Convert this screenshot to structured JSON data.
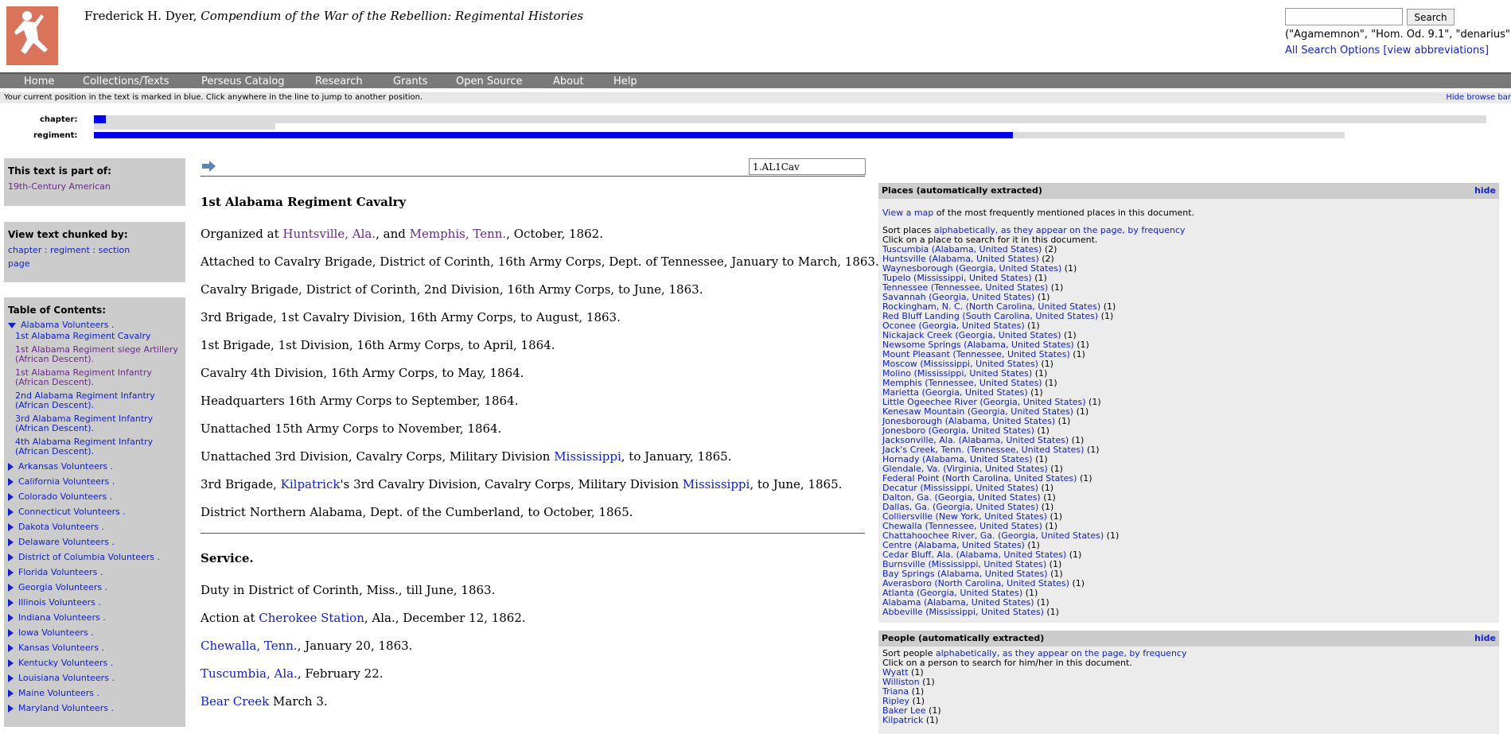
{
  "header": {
    "title_author": "Frederick H. Dyer, ",
    "title_work": "Compendium of the War of the Rebellion: Regimental Histories",
    "search_button": "Search",
    "search_examples": "(\"Agamemnon\", \"Hom. Od. 9.1\", \"denarius\")",
    "all_search_options": "All Search Options",
    "view_abbreviations": "[view abbreviations]"
  },
  "nav": [
    "Home",
    "Collections/Texts",
    "Perseus Catalog",
    "Research",
    "Grants",
    "Open Source",
    "About",
    "Help"
  ],
  "browse": {
    "note": "Your current position in the text is marked in blue. Click anywhere in the line to jump to another position.",
    "hide_label": "Hide browse bar",
    "chapter_label": "chapter:",
    "regiment_label": "regiment:"
  },
  "sidebar": {
    "part_of_title": "This text is part of:",
    "part_of_link": "19th-Century American",
    "chunked_title": "View text chunked by:",
    "chunk_options_line1": "chapter : regiment : section",
    "chunk_options_line2": "page",
    "toc_title": "Table of Contents:",
    "toc_expanded": "Alabama Volunteers .",
    "toc_sub": [
      "1st Alabama Regiment Cavalry",
      "1st Alabama Regiment siege Artillery (African Descent).",
      "1st Alabama Regiment Infantry (African Descent).",
      "2nd Alabama Regiment Infantry (African Descent).",
      "3rd Alabama Regiment Infantry (African Descent).",
      "4th Alabama Regiment Infantry (African Descent)."
    ],
    "toc_items": [
      "Arkansas Volunteers .",
      "California Volunteers .",
      "Colorado Volunteers .",
      "Connecticut Volunteers .",
      "Dakota Volunteers .",
      "Delaware Volunteers .",
      "District of Columbia Volunteers .",
      "Florida Volunteers .",
      "Georgia Volunteers .",
      "Illinois Volunteers .",
      "Indiana Volunteers .",
      "Iowa Volunteers .",
      "Kansas Volunteers .",
      "Kentucky Volunteers .",
      "Louisiana Volunteers .",
      "Maine Volunteers .",
      "Maryland Volunteers ."
    ]
  },
  "main": {
    "position_value": "1.AL1Cav",
    "heading": "1st Alabama Regiment Cavalry",
    "p1": {
      "a": "Organized at ",
      "b": "Huntsville, Ala.",
      "c": ", and ",
      "d": "Memphis, Tenn.",
      "e": ", October, 1862."
    },
    "lines": [
      "Attached to Cavalry Brigade, District of Corinth, 16th Army Corps, Dept. of Tennessee, January to March, 1863.",
      "Cavalry Brigade, District of Corinth, 2nd Division, 16th Army Corps, to June, 1863.",
      "3rd Brigade, 1st Cavalry Division, 16th Army Corps, to August, 1863.",
      "1st Brigade, 1st Division, 16th Army Corps, to April, 1864.",
      "Cavalry 4th Division, 16th Army Corps, to May, 1864.",
      "Headquarters 16th Army Corps to September, 1864.",
      "Unattached 15th Army Corps to November, 1864."
    ],
    "p9": {
      "a": "Unattached 3rd Division, Cavalry Corps, Military Division ",
      "b": "Mississippi",
      "c": ", to January, 1865."
    },
    "p10": {
      "a": "3rd Brigade, ",
      "b": "Kilpatrick",
      "c": "'s 3rd Cavalry Division, Cavalry Corps, Military Division ",
      "d": "Mississippi",
      "e": ", to June, 1865."
    },
    "p11": "District Northern Alabama, Dept. of the Cumberland, to October, 1865.",
    "service_heading": "Service.",
    "s1": "Duty in District of Corinth, Miss., till June, 1863.",
    "s2": {
      "a": "Action at ",
      "b": "Cherokee Station",
      "c": ", Ala., December 12, 1862."
    },
    "s3": {
      "a": "Chewalla, Tenn.",
      "b": ", January 20, 1863."
    },
    "s4": {
      "a": "Tuscumbia, Ala.",
      "b": ", February 22."
    },
    "s5": {
      "a": "Bear Creek",
      "b": " March 3."
    }
  },
  "places_panel": {
    "title": "Places (automatically extracted)",
    "hide": "hide",
    "map_link": "View a map",
    "map_text": " of the most frequently mentioned places in this document.",
    "sort_text": "Sort places ",
    "sort_links": "alphabetically, as they appear on the page, by frequency",
    "click_text": "Click on a place to search for it in this document.",
    "places": [
      [
        "Tuscumbia (Alabama, United States)",
        "(2)"
      ],
      [
        "Huntsville (Alabama, United States)",
        "(2)"
      ],
      [
        "Waynesborough (Georgia, United States)",
        "(1)"
      ],
      [
        "Tupelo (Mississippi, United States)",
        "(1)"
      ],
      [
        "Tennessee (Tennessee, United States)",
        "(1)"
      ],
      [
        "Savannah (Georgia, United States)",
        "(1)"
      ],
      [
        "Rockingham, N. C. (North Carolina, United States)",
        "(1)"
      ],
      [
        "Red Bluff Landing (South Carolina, United States)",
        "(1)"
      ],
      [
        "Oconee (Georgia, United States)",
        "(1)"
      ],
      [
        "Nickajack Creek (Georgia, United States)",
        "(1)"
      ],
      [
        "Newsome Springs (Alabama, United States)",
        "(1)"
      ],
      [
        "Mount Pleasant (Tennessee, United States)",
        "(1)"
      ],
      [
        "Moscow (Mississippi, United States)",
        "(1)"
      ],
      [
        "Molino (Mississippi, United States)",
        "(1)"
      ],
      [
        "Memphis (Tennessee, United States)",
        "(1)"
      ],
      [
        "Marietta (Georgia, United States)",
        "(1)"
      ],
      [
        "Little Ogeechee River (Georgia, United States)",
        "(1)"
      ],
      [
        "Kenesaw Mountain (Georgia, United States)",
        "(1)"
      ],
      [
        "Jonesborough (Alabama, United States)",
        "(1)"
      ],
      [
        "Jonesboro (Georgia, United States)",
        "(1)"
      ],
      [
        "Jacksonville, Ala. (Alabama, United States)",
        "(1)"
      ],
      [
        "Jack's Creek, Tenn. (Tennessee, United States)",
        "(1)"
      ],
      [
        "Hornady (Alabama, United States)",
        "(1)"
      ],
      [
        "Glendale, Va. (Virginia, United States)",
        "(1)"
      ],
      [
        "Federal Point (North Carolina, United States)",
        "(1)"
      ],
      [
        "Decatur (Mississippi, United States)",
        "(1)"
      ],
      [
        "Dalton, Ga. (Georgia, United States)",
        "(1)"
      ],
      [
        "Dallas, Ga. (Georgia, United States)",
        "(1)"
      ],
      [
        "Colliersville (New York, United States)",
        "(1)"
      ],
      [
        "Chewalla (Tennessee, United States)",
        "(1)"
      ],
      [
        "Chattahoochee River, Ga. (Georgia, United States)",
        "(1)"
      ],
      [
        "Centre (Alabama, United States)",
        "(1)"
      ],
      [
        "Cedar Bluff, Ala. (Alabama, United States)",
        "(1)"
      ],
      [
        "Burnsville (Mississippi, United States)",
        "(1)"
      ],
      [
        "Bay Springs (Alabama, United States)",
        "(1)"
      ],
      [
        "Averasboro (North Carolina, United States)",
        "(1)"
      ],
      [
        "Atlanta (Georgia, United States)",
        "(1)"
      ],
      [
        "Alabama (Alabama, United States)",
        "(1)"
      ],
      [
        "Abbeville (Mississippi, United States)",
        "(1)"
      ]
    ]
  },
  "people_panel": {
    "title": "People (automatically extracted)",
    "hide": "hide",
    "sort_text": "Sort people ",
    "sort_links": "alphabetically, as they appear on the page, by frequency",
    "click_text": "Click on a person to search for him/her in this document.",
    "people": [
      [
        "Wyatt",
        "(1)"
      ],
      [
        "Williston",
        "(1)"
      ],
      [
        "Triana",
        "(1)"
      ],
      [
        "Ripley",
        "(1)"
      ],
      [
        "Baker Lee",
        "(1)"
      ],
      [
        "Kilpatrick",
        "(1)"
      ]
    ]
  }
}
